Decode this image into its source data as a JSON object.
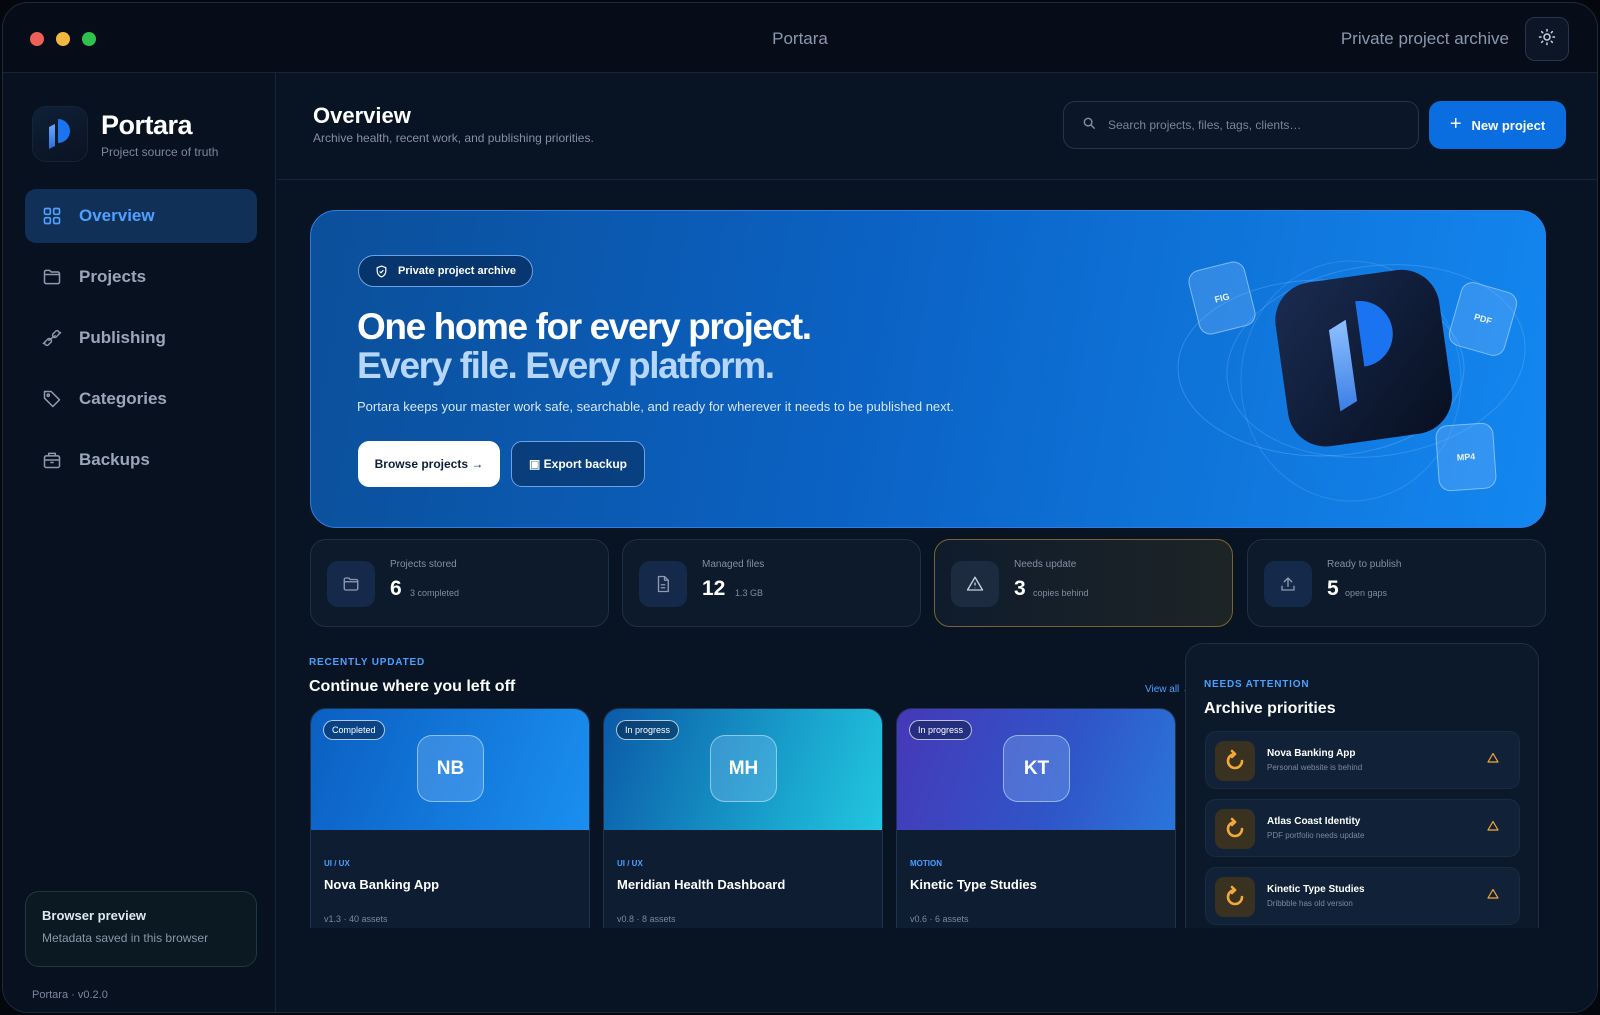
{
  "window": {
    "title": "Portara",
    "right_label": "Private project archive",
    "theme_toggle_icon": "sun-icon"
  },
  "sidebar": {
    "brand_name": "Portara",
    "brand_sub": "Project source of truth",
    "items": [
      {
        "label": "Overview",
        "icon": "grid-icon",
        "active": true
      },
      {
        "label": "Projects",
        "icon": "folder-icon",
        "active": false
      },
      {
        "label": "Publishing",
        "icon": "link-icon",
        "active": false
      },
      {
        "label": "Categories",
        "icon": "tag-icon",
        "active": false
      },
      {
        "label": "Backups",
        "icon": "archive-icon",
        "active": false
      }
    ],
    "preview_title": "Browser preview",
    "preview_sub": "Metadata saved in this browser",
    "version": "Portara · v0.2.0"
  },
  "header": {
    "title": "Overview",
    "subtitle": "Archive health, recent work, and publishing priorities.",
    "search_placeholder": "Search projects, files, tags, clients…",
    "new_project_label": "New project"
  },
  "hero": {
    "badge": "Private project archive",
    "headline_1": "One home for every project.",
    "headline_2": "Every file. Every platform.",
    "description": "Portara keeps your master work safe, searchable, and ready for wherever it needs to be published next.",
    "browse_label": "Browse projects →",
    "export_label": "▣ Export backup",
    "file_chips": [
      "FIG",
      "PDF",
      "MP4"
    ]
  },
  "stats": [
    {
      "label": "Projects stored",
      "value": "6",
      "note": "3 completed",
      "icon": "folder-icon"
    },
    {
      "label": "Managed files",
      "value": "12",
      "note": "1.3 GB",
      "icon": "file-icon"
    },
    {
      "label": "Needs update",
      "value": "3",
      "note": "copies behind",
      "icon": "warning-icon"
    },
    {
      "label": "Ready to publish",
      "value": "5",
      "note": "open gaps",
      "icon": "upload-icon"
    }
  ],
  "recent": {
    "kicker": "RECENTLY UPDATED",
    "title": "Continue where you left off",
    "view_all": "View all →",
    "projects": [
      {
        "status": "Completed",
        "initials": "NB",
        "category": "UI / UX",
        "name": "Nova Banking App",
        "meta": "v1.3 · 40 assets"
      },
      {
        "status": "In progress",
        "initials": "MH",
        "category": "UI / UX",
        "name": "Meridian Health Dashboard",
        "meta": "v0.8 · 8 assets"
      },
      {
        "status": "In progress",
        "initials": "KT",
        "category": "MOTION",
        "name": "Kinetic Type Studies",
        "meta": "v0.6 · 6 assets"
      }
    ]
  },
  "priorities": {
    "kicker": "NEEDS ATTENTION",
    "title": "Archive priorities",
    "items": [
      {
        "name": "Nova Banking App",
        "desc": "Personal website is behind"
      },
      {
        "name": "Atlas Coast Identity",
        "desc": "PDF portfolio needs update"
      },
      {
        "name": "Kinetic Type Studies",
        "desc": "Dribbble has old version"
      }
    ]
  },
  "colors": {
    "accent": "#0a6ee0",
    "accent_text": "#4aa0ff",
    "warning": "#f2a83a",
    "background": "#081424"
  }
}
